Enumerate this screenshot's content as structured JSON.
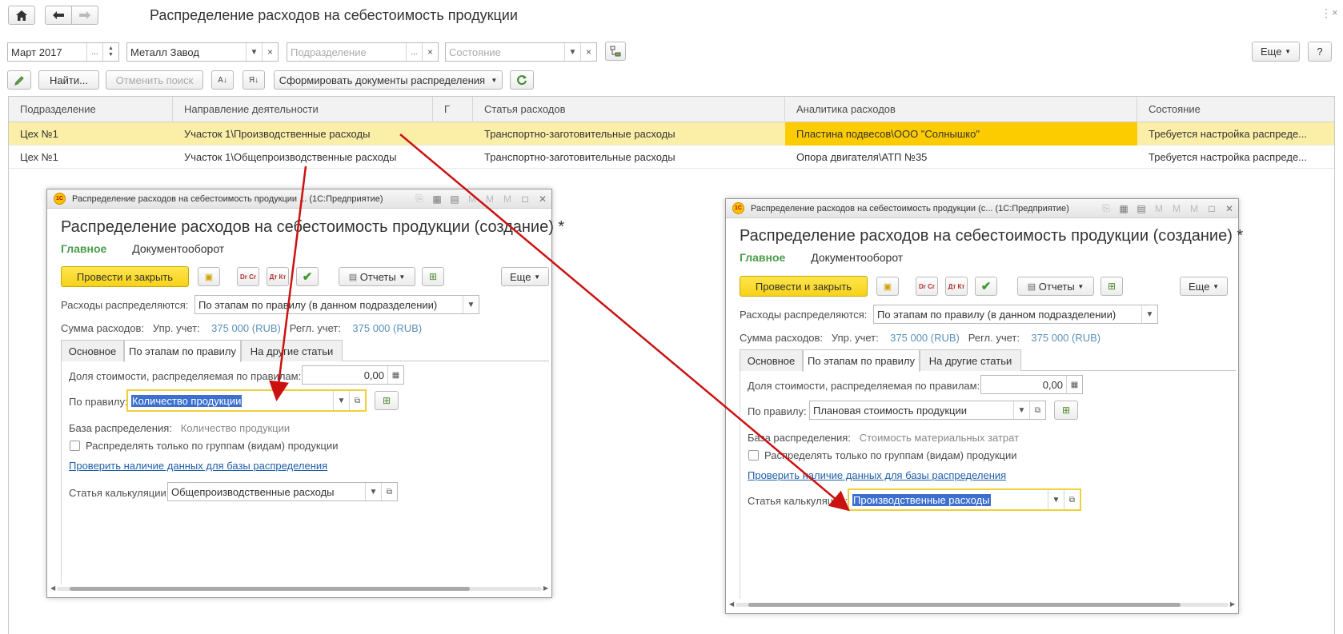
{
  "toolbar": {
    "home_icon": "home-icon",
    "back_icon": "arrow-left-icon",
    "forward_icon": "arrow-right-icon",
    "title": "Распределение расходов на себестоимость продукции"
  },
  "filters": {
    "period": "Март 2017",
    "organization": "Металл Завод",
    "department_placeholder": "Подразделение",
    "state_placeholder": "Состояние",
    "more": "Еще",
    "help": "?"
  },
  "actions": {
    "find": "Найти...",
    "cancel_search": "Отменить поиск",
    "generate": "Сформировать документы распределения"
  },
  "grid": {
    "columns": [
      "Подразделение",
      "Направление деятельности",
      "Г",
      "Статья расходов",
      "Аналитика расходов",
      "Состояние"
    ],
    "rows": [
      [
        "Цех №1",
        "Участок 1\\Производственные расходы",
        "",
        "Транспортно-заготовительные расходы",
        "Пластина подвесов\\ООО \"Солнышко\"",
        "Требуется настройка распреде..."
      ],
      [
        "Цех №1",
        "Участок 1\\Общепроизводственные расходы",
        "",
        "Транспортно-заготовительные расходы",
        "Опора двигателя\\АТП №35",
        "Требуется настройка распреде..."
      ]
    ]
  },
  "win1": {
    "titlebar": "Распределение расходов на себестоимость продукции ... (1С:Предприятие)",
    "heading": "Распределение расходов на себестоимость продукции (создание) *",
    "tab_main": "Главное",
    "tab_docflow": "Документооборот",
    "post_close": "Провести и закрыть",
    "reports": "Отчеты",
    "more": "Еще",
    "distributed_label": "Расходы распределяются:",
    "distributed_value": "По этапам по правилу (в данном подразделении)",
    "sum_label": "Сумма расходов:",
    "mgmt_label": "Упр. учет:",
    "mgmt_value": "375 000 (RUB)",
    "reg_label": "Регл. учет:",
    "reg_value": "375 000 (RUB)",
    "tabs": [
      "Основное",
      "По этапам по правилу",
      "На другие статьи"
    ],
    "share_label": "Доля стоимости, распределяемая по правилам:",
    "share_value": "0,00",
    "rule_label": "По правилу:",
    "rule_value": "Количество продукции",
    "base_label": "База распределения:",
    "base_value": "Количество продукции",
    "groups_label": "Распределять только по группам (видам) продукции",
    "check_link": "Проверить наличие данных для базы распределения",
    "calc_label": "Статья калькуляции:",
    "calc_value": "Общепроизводственные расходы"
  },
  "win2": {
    "titlebar": "Распределение расходов на себестоимость продукции (с... (1С:Предприятие)",
    "heading": "Распределение расходов на себестоимость продукции (создание) *",
    "tab_main": "Главное",
    "tab_docflow": "Документооборот",
    "post_close": "Провести и закрыть",
    "reports": "Отчеты",
    "more": "Еще",
    "distributed_label": "Расходы распределяются:",
    "distributed_value": "По этапам по правилу (в данном подразделении)",
    "sum_label": "Сумма расходов:",
    "mgmt_label": "Упр. учет:",
    "mgmt_value": "375 000 (RUB)",
    "reg_label": "Регл. учет:",
    "reg_value": "375 000 (RUB)",
    "tabs": [
      "Основное",
      "По этапам по правилу",
      "На другие статьи"
    ],
    "share_label": "Доля стоимости, распределяемая по правилам:",
    "share_value": "0,00",
    "rule_label": "По правилу:",
    "rule_value": "Плановая стоимость продукции",
    "base_label": "База распределения:",
    "base_value": "Стоимость материальных затрат",
    "groups_label": "Распределять только по группам (видам) продукции",
    "check_link": "Проверить наличие данных для базы распределения",
    "calc_label": "Статья калькуляции:",
    "calc_value": "Производственные расходы"
  },
  "colors": {
    "selected_row": "#fbeea7",
    "highlight_cell": "#fccc00",
    "post_button": "#f7d21a",
    "arrow": "#cc1111",
    "link": "#1f5fa8",
    "amount": "#5a8fba"
  }
}
